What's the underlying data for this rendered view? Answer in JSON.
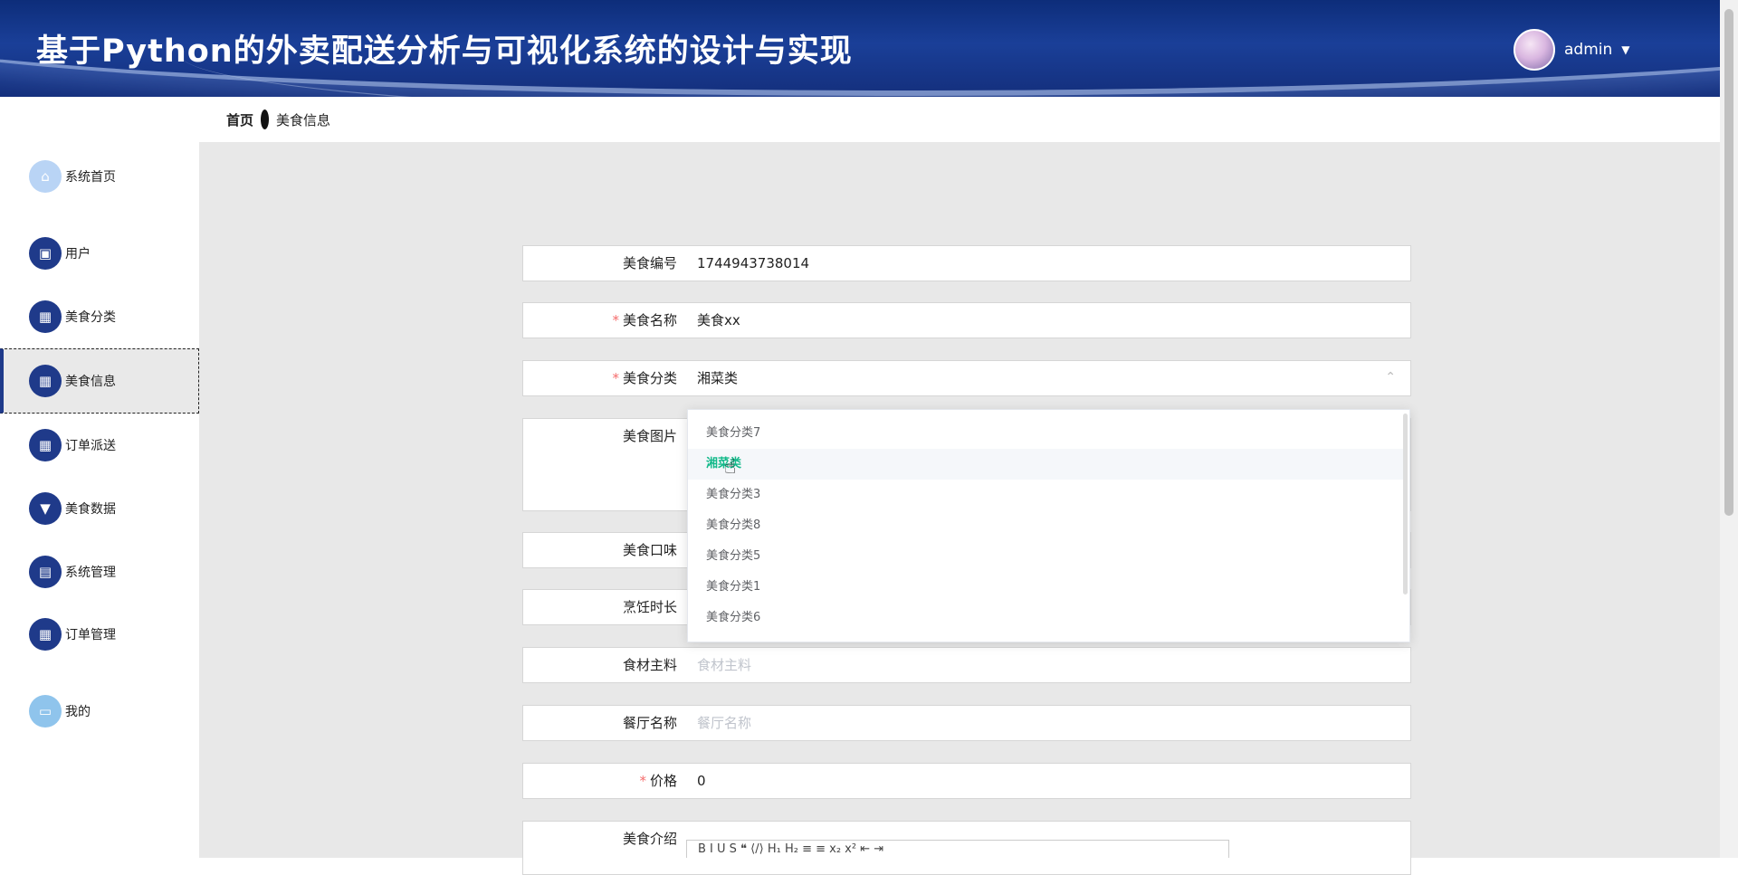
{
  "header": {
    "title": "基于Python的外卖配送分析与可视化系统的设计与实现"
  },
  "user": {
    "name": "admin"
  },
  "breadcrumb": {
    "home": "首页",
    "current": "美食信息"
  },
  "sidebar": {
    "items": [
      {
        "label": "系统首页",
        "icon": "home-icon"
      },
      {
        "label": "用户",
        "icon": "user-icon"
      },
      {
        "label": "美食分类",
        "icon": "grid-icon"
      },
      {
        "label": "美食信息",
        "icon": "grid-icon"
      },
      {
        "label": "订单派送",
        "icon": "grid-icon"
      },
      {
        "label": "美食数据",
        "icon": "brush-icon"
      },
      {
        "label": "系统管理",
        "icon": "table-icon"
      },
      {
        "label": "订单管理",
        "icon": "grid-icon"
      },
      {
        "label": "我的",
        "icon": "card-icon"
      }
    ]
  },
  "form": {
    "code": {
      "label": "美食编号",
      "value": "1744943738014"
    },
    "name": {
      "label": "美食名称",
      "value": "美食xx",
      "required": true
    },
    "category": {
      "label": "美食分类",
      "value": "湘菜类",
      "required": true
    },
    "image": {
      "label": "美食图片"
    },
    "taste": {
      "label": "美食口味"
    },
    "duration": {
      "label": "烹饪时长"
    },
    "ingredients": {
      "label": "食材主料",
      "placeholder": "食材主料"
    },
    "restaurant": {
      "label": "餐厅名称",
      "placeholder": "餐厅名称"
    },
    "price": {
      "label": "价格",
      "value": "0",
      "required": true
    },
    "intro": {
      "label": "美食介绍"
    }
  },
  "dropdown": {
    "options": [
      "美食分类7",
      "湘菜类",
      "美食分类3",
      "美食分类8",
      "美食分类5",
      "美食分类1",
      "美食分类6"
    ],
    "selected": "湘菜类"
  },
  "toolbar": {
    "text": "B  I  U  S  ❝  ⟨/⟩  H₁  H₂  ≡  ≡  x₂  x²  ⇤  ⇥"
  }
}
